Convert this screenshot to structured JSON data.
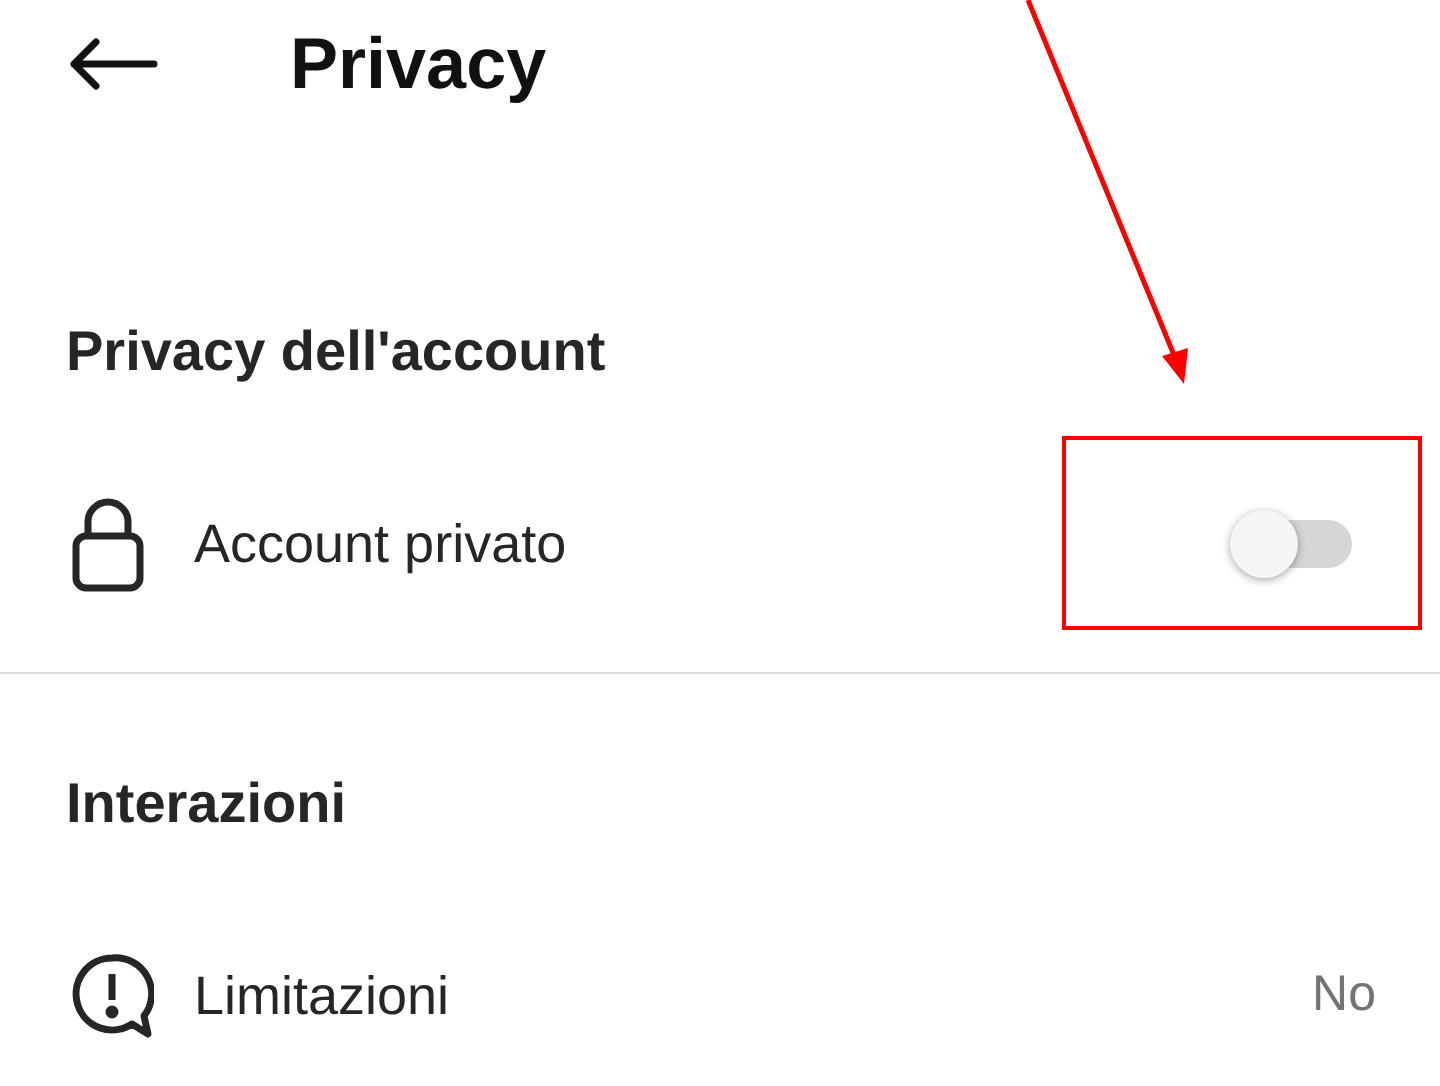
{
  "header": {
    "title": "Privacy"
  },
  "sections": [
    {
      "title": "Privacy dell'account",
      "items": [
        {
          "kind": "toggle",
          "label": "Account privato",
          "on": false
        }
      ]
    },
    {
      "title": "Interazioni",
      "items": [
        {
          "kind": "value",
          "label": "Limitazioni",
          "value": "No"
        }
      ]
    }
  ]
}
